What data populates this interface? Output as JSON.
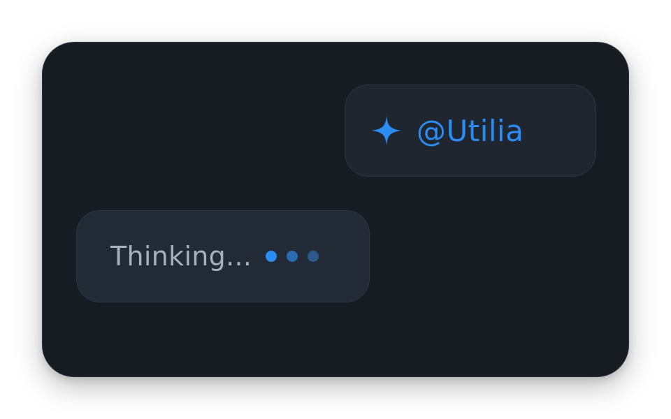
{
  "mention": {
    "label": "@Utilia",
    "icon": "sparkle-icon",
    "accent_color": "#2b8cf2"
  },
  "status": {
    "label": "Thinking...",
    "indicator_icon": "typing-dots-icon"
  }
}
